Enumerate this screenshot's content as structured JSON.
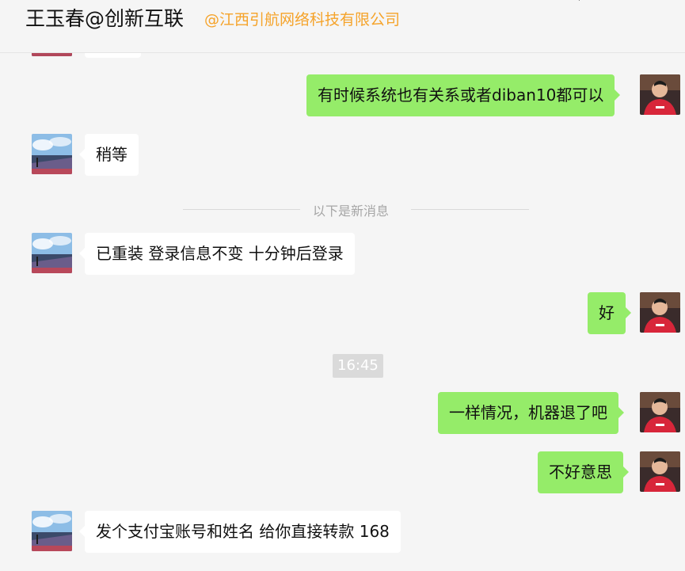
{
  "header": {
    "title": "王玉春@创新互联",
    "organization": "@江西引航网络科技有限公司",
    "dot": "·"
  },
  "messages": [
    {
      "id": "m1",
      "side": "out",
      "text": "有时候系统也有关系或者diban10都可以"
    },
    {
      "id": "m2",
      "side": "in",
      "text": "稍等"
    },
    {
      "id": "m3",
      "side": "in",
      "text": "已重装  登录信息不变  十分钟后登录"
    },
    {
      "id": "m4",
      "side": "out",
      "text": "好"
    },
    {
      "id": "m5",
      "side": "out",
      "text": "一样情况，机器退了吧"
    },
    {
      "id": "m6",
      "side": "out",
      "text": "不好意思"
    },
    {
      "id": "m7",
      "side": "in",
      "text": "发个支付宝账号和姓名 给你直接转款   168"
    }
  ],
  "divider": {
    "text": "以下是新消息"
  },
  "timestamp": {
    "text": "16:45"
  },
  "colors": {
    "outgoing_bubble": "#95ec69",
    "incoming_bubble": "#ffffff",
    "org_text": "#f5a32a",
    "background": "#f5f5f5"
  },
  "icons": {
    "contact_avatar": "landscape-avatar",
    "self_avatar": "person-red-shirt-avatar"
  }
}
